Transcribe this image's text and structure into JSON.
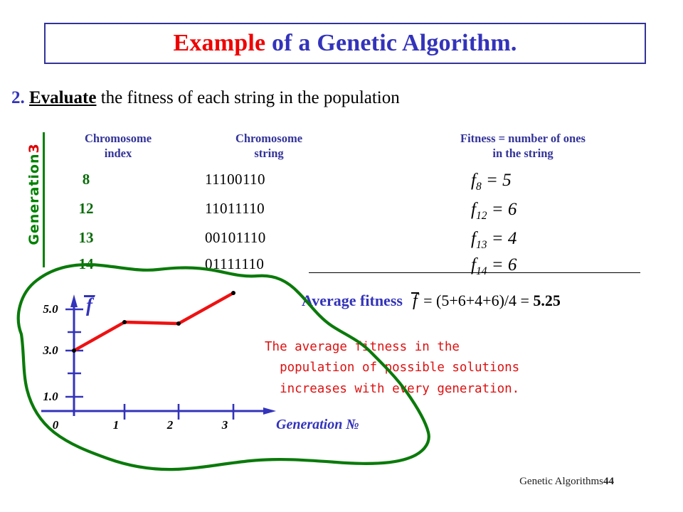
{
  "title": {
    "part_red": "Example",
    "part_blue": " of a Genetic Algorithm."
  },
  "step": {
    "number": "2.",
    "keyword": "Evaluate",
    "rest": " the fitness of each string in the population"
  },
  "generation_marker": {
    "word": "Generation",
    "number": "3"
  },
  "table": {
    "headers": {
      "index": "Chromosome\nindex",
      "string": "Chromosome\nstring",
      "fitness": "Fitness = number of ones\nin the string"
    },
    "rows": [
      {
        "index": "8",
        "string": "11100110",
        "fitness_symbol": "f",
        "fitness_sub": "8",
        "fitness_value": "5"
      },
      {
        "index": "12",
        "string": "11011110",
        "fitness_symbol": "f",
        "fitness_sub": "12",
        "fitness_value": "6"
      },
      {
        "index": "13",
        "string": "00101110",
        "fitness_symbol": "f",
        "fitness_sub": "13",
        "fitness_value": "4"
      },
      {
        "index": "14",
        "string": "01111110",
        "fitness_symbol": "f",
        "fitness_sub": "14",
        "fitness_value": "6"
      }
    ]
  },
  "average": {
    "label": "Average fitness",
    "symbol": "f",
    "expression": " =  (5+6+4+6)/4  = ",
    "value": "5.25"
  },
  "note": {
    "line1": "The average fitness in the",
    "line2": "  population of possible solutions",
    "line3": "  increases with every generation."
  },
  "chart_data": {
    "type": "line",
    "title": "",
    "xlabel": "Generation №",
    "ylabel": "f̄",
    "x": [
      0,
      1,
      2,
      3
    ],
    "values": [
      3.0,
      4.5,
      4.45,
      5.25
    ],
    "xtick_labels": [
      "0",
      "1",
      "2",
      "3"
    ],
    "ytick_labels": [
      "1.0",
      "3.0",
      "5.0"
    ],
    "ytick_values": [
      1.0,
      3.0,
      5.0
    ],
    "yminor_values": [
      2.0,
      4.0
    ],
    "xlim": [
      0,
      3.6
    ],
    "ylim": [
      0,
      6.0
    ],
    "grid": false,
    "legend": null,
    "line_color": "#ee1111",
    "marker_color": "#000000",
    "axis_color": "#3333bb",
    "annotation_shape": "hand-drawn green ellipse highlight",
    "annotation_color": "#0a7a0a"
  },
  "colors": {
    "title_red": "#ee0000",
    "title_blue": "#3333bb",
    "index_green": "#0a6b0a",
    "note_red": "#dd1111",
    "highlight_green": "#0a7a0a"
  },
  "footer": {
    "title": "Genetic Algorithms",
    "page": "44"
  }
}
